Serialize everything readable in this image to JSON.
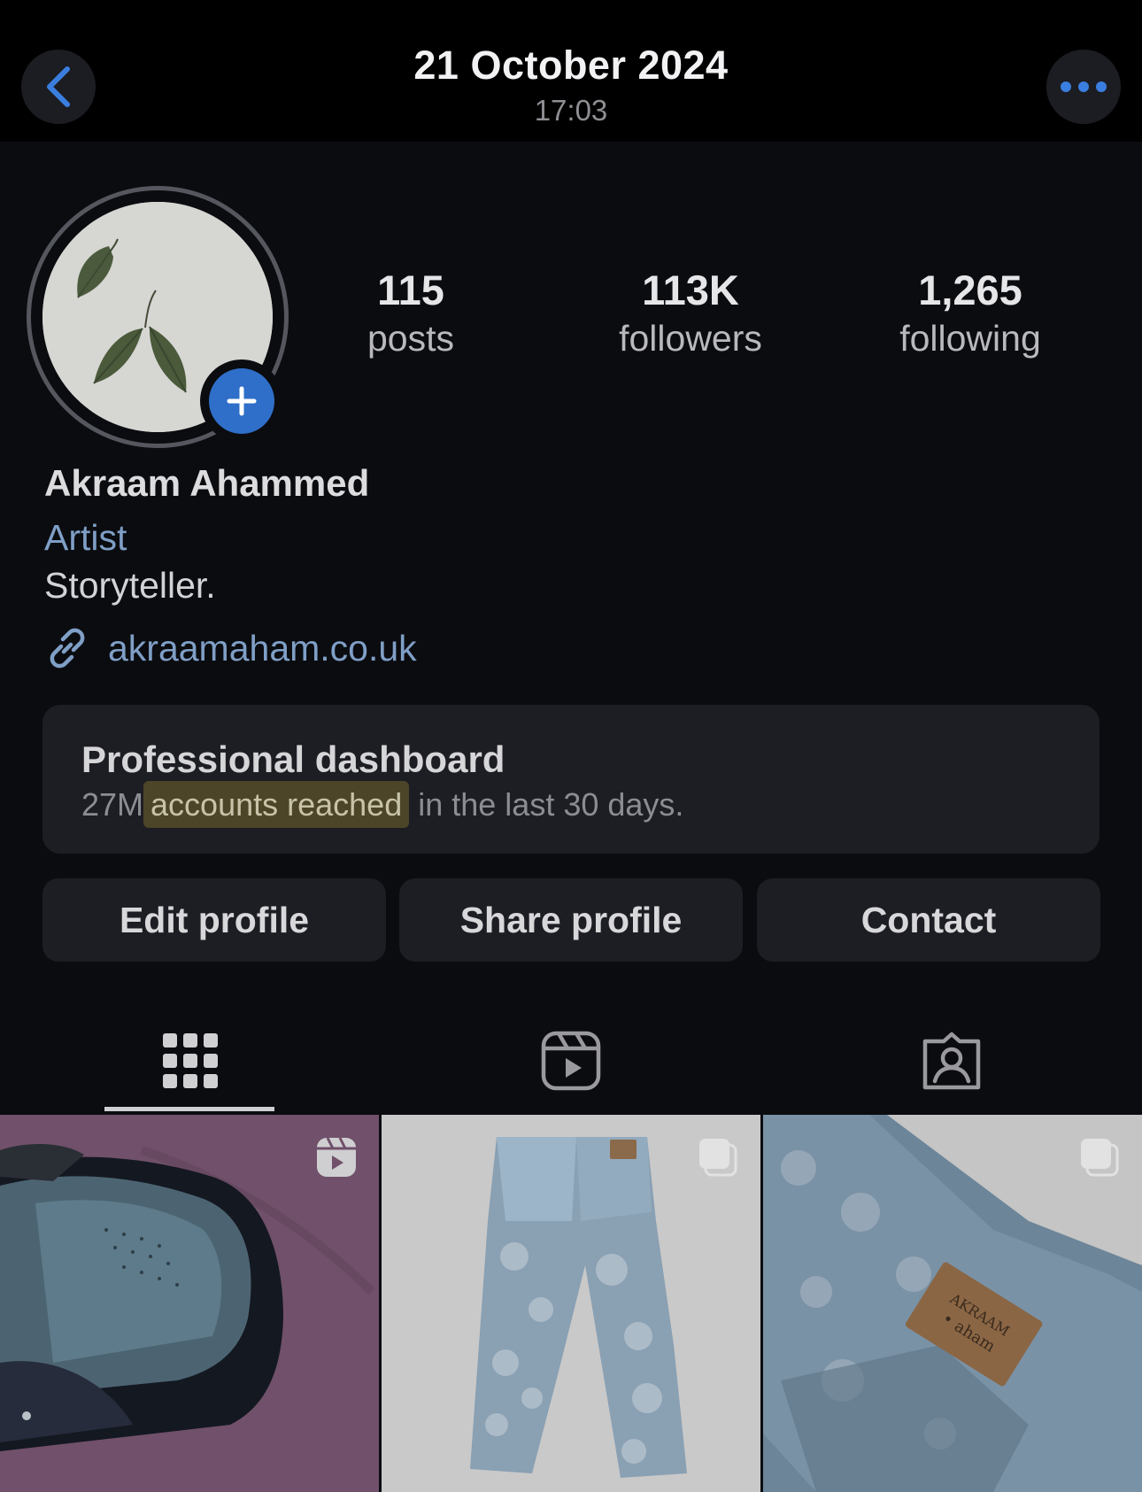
{
  "header": {
    "date": "21 October 2024",
    "time": "17:03"
  },
  "icons": {
    "back": "chevron-left-icon",
    "more": "ellipsis-icon",
    "add": "plus-icon",
    "link": "link-icon",
    "posts_tab": "grid-icon",
    "reels_tab": "reels-icon",
    "tagged_tab": "tagged-person-icon"
  },
  "colors": {
    "accent": "#3a7ee0",
    "background": "#0b0c10",
    "card": "#1d1e23",
    "link": "#7f9fc6",
    "highlight": "#4d4527"
  },
  "stats": [
    {
      "value": "115",
      "label": "posts"
    },
    {
      "value": "113K",
      "label": "followers"
    },
    {
      "value": "1,265",
      "label": "following"
    }
  ],
  "profile": {
    "name": "Akraam Ahammed",
    "category": "Artist",
    "bio": "Storyteller.",
    "link": "akraamaham.co.uk"
  },
  "dashboard": {
    "title": "Professional dashboard",
    "count": "27M",
    "highlight": "accounts reached",
    "suffix": "in the last 30 days."
  },
  "buttons": {
    "edit": "Edit profile",
    "share": "Share profile",
    "contact": "Contact"
  },
  "posts": [
    {
      "type": "reel",
      "subject": "sneaker on pink fabric"
    },
    {
      "type": "carousel",
      "subject": "bleached jeans"
    },
    {
      "type": "carousel",
      "subject": "jeans back pocket label",
      "label_line1": "AKRAAM",
      "label_line2": "• aham"
    }
  ]
}
